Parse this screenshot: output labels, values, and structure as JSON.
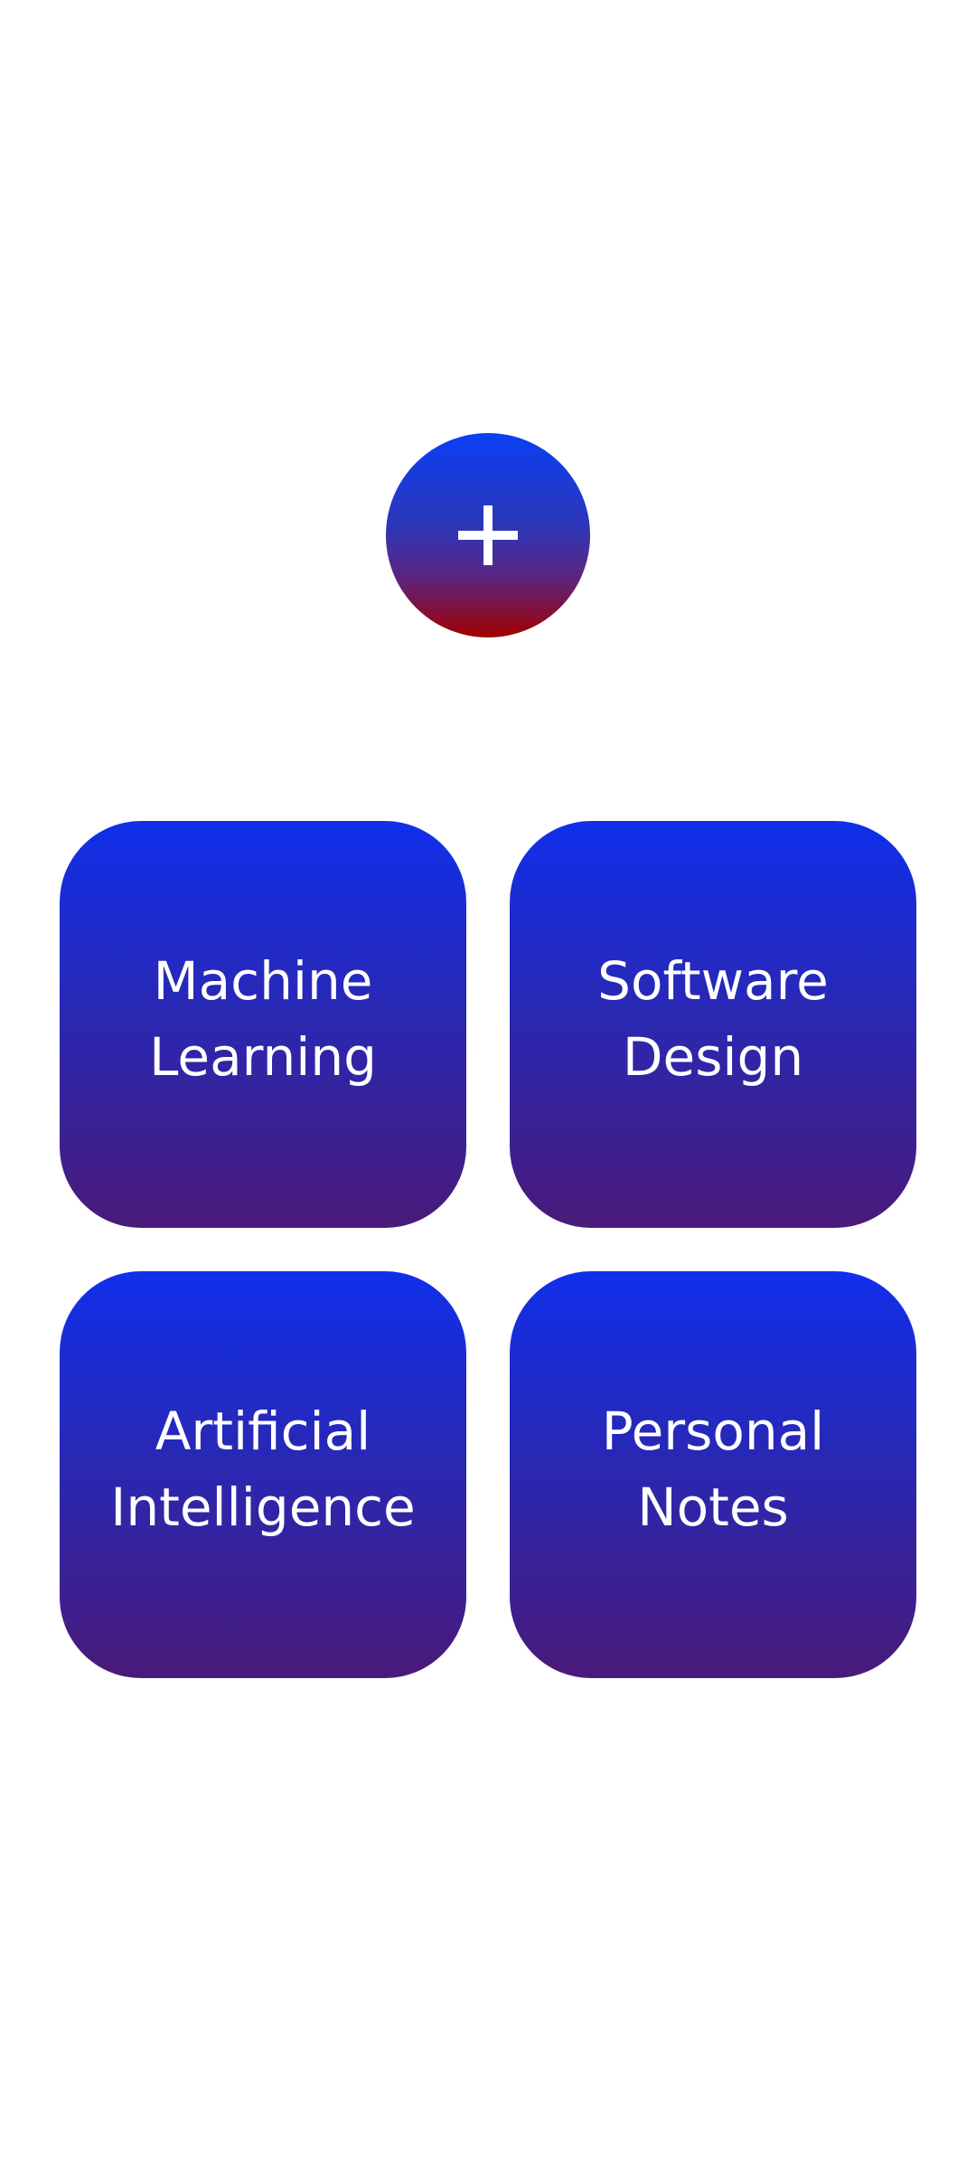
{
  "add_button": {
    "icon": "plus-icon",
    "gradient_colors": [
      "#0a3ff5",
      "#a00000"
    ]
  },
  "categories": [
    {
      "label": "Machine\nLearning"
    },
    {
      "label": "Software\nDesign"
    },
    {
      "label": "Artificial\nIntelligence"
    },
    {
      "label": "Personal\nNotes"
    }
  ],
  "card_gradient_colors": [
    "#102fea",
    "#4a1a79"
  ]
}
